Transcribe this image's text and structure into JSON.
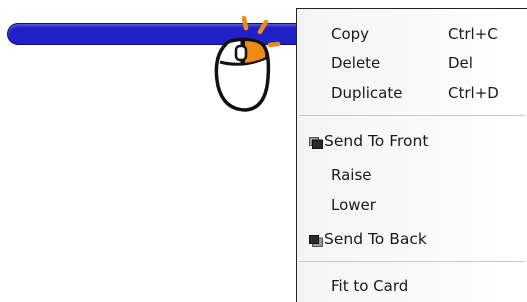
{
  "colors": {
    "bar_fill": "#2020c8",
    "bar_border": "#101070",
    "click_accent": "#f08a10",
    "menu_background": "#f6f6f6",
    "menu_border": "#222222",
    "separator": "#c9c9c9"
  },
  "pointer": {
    "icon": "mouse-right-click-icon"
  },
  "context_menu": {
    "items": [
      {
        "label": "Copy",
        "shortcut": "Ctrl+C"
      },
      {
        "label": "Delete",
        "shortcut": "Del"
      },
      {
        "label": "Duplicate",
        "shortcut": "Ctrl+D"
      },
      {
        "label": "Send To Front",
        "icon": "send-to-front-icon"
      },
      {
        "label": "Raise"
      },
      {
        "label": "Lower"
      },
      {
        "label": "Send To Back",
        "icon": "send-to-back-icon"
      },
      {
        "label": "Fit to Card"
      }
    ]
  }
}
